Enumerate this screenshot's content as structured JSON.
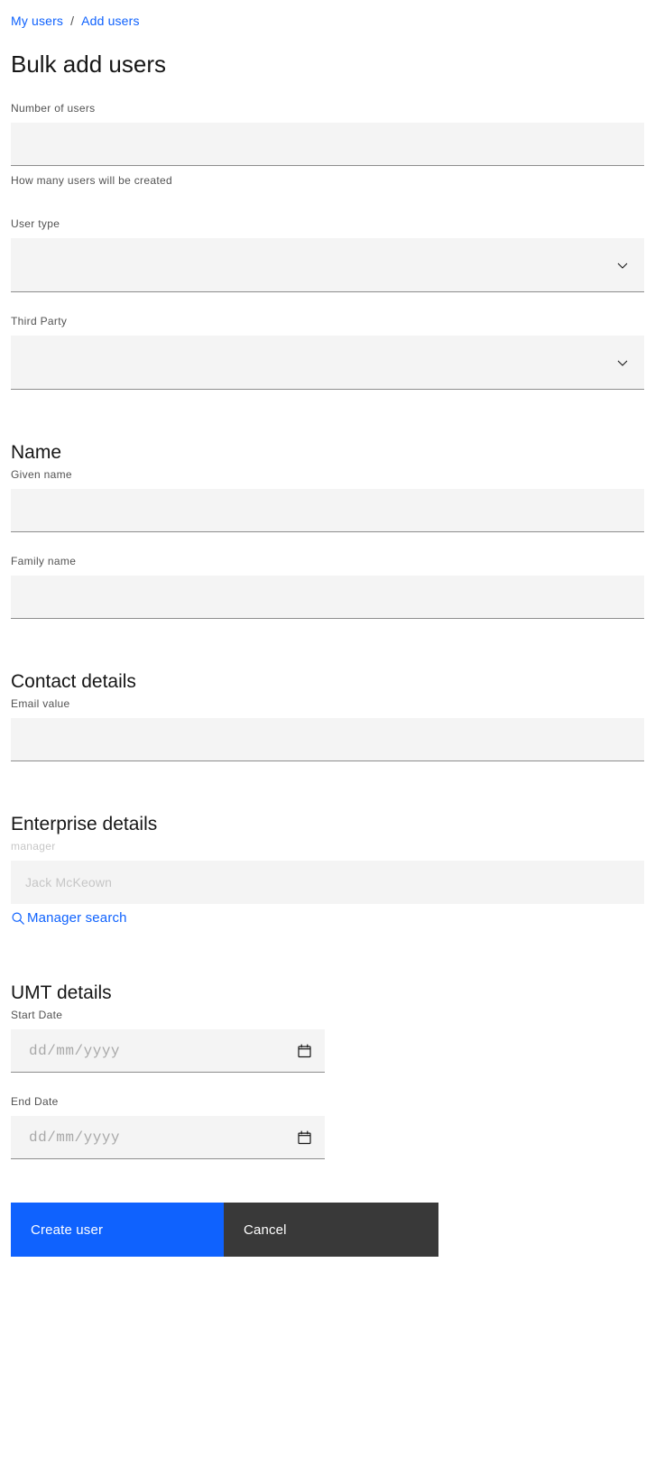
{
  "breadcrumb": {
    "items": [
      {
        "label": "My users"
      },
      {
        "label": "Add users"
      }
    ],
    "separator": "/"
  },
  "page": {
    "title": "Bulk add users"
  },
  "fields": {
    "number_of_users": {
      "label": "Number of users",
      "value": "",
      "placeholder": "",
      "helper": "How many users will be created"
    },
    "user_type": {
      "label": "User type",
      "value": "",
      "icon": "chevron-down-icon"
    },
    "third_party": {
      "label": "Third Party",
      "value": "",
      "icon": "chevron-down-icon"
    },
    "given_name": {
      "label": "Given name",
      "value": "",
      "placeholder": ""
    },
    "family_name": {
      "label": "Family name",
      "value": "",
      "placeholder": ""
    },
    "email_value": {
      "label": "Email value",
      "value": "",
      "placeholder": ""
    },
    "manager": {
      "label": "manager",
      "value": "",
      "placeholder": "Jack McKeown"
    },
    "start_date": {
      "label": "Start Date",
      "value": "",
      "placeholder": "dd/mm/yyyy",
      "icon": "calendar-icon"
    },
    "end_date": {
      "label": "End Date",
      "value": "",
      "placeholder": "dd/mm/yyyy",
      "icon": "calendar-icon"
    }
  },
  "sections": {
    "name": {
      "title": "Name"
    },
    "contact": {
      "title": "Contact details"
    },
    "enterprise": {
      "title": "Enterprise details"
    },
    "umt": {
      "title": "UMT details"
    }
  },
  "links": {
    "manager_search": {
      "label": "Manager search",
      "icon": "search-icon"
    }
  },
  "actions": {
    "create": {
      "label": "Create user"
    },
    "cancel": {
      "label": "Cancel"
    }
  },
  "colors": {
    "link": "#0f62fe",
    "primary_button": "#0f62fe",
    "secondary_button": "#393939",
    "field_background": "#f4f4f4",
    "field_border": "#8d8d8d",
    "label_text": "#525252",
    "disabled_text": "#c6c6c6"
  }
}
